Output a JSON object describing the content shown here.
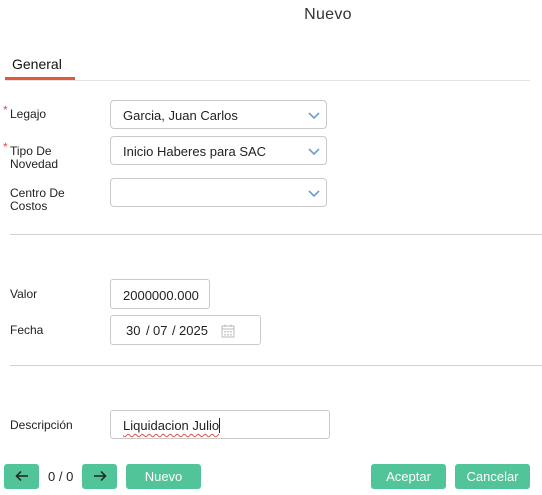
{
  "header": {
    "title": "Nuevo"
  },
  "tabs": [
    {
      "label": "General",
      "active": true
    }
  ],
  "form": {
    "legajo": {
      "label": "Legajo",
      "value": "Garcia, Juan Carlos",
      "required": true
    },
    "tipo_novedad": {
      "label_line1": "Tipo De",
      "label_line2": "Novedad",
      "value": "Inicio Haberes para SAC",
      "required": true
    },
    "centro_costos": {
      "label_line1": "Centro De",
      "label_line2": "Costos",
      "value": ""
    },
    "valor": {
      "label": "Valor",
      "value": "2000000.000"
    },
    "fecha": {
      "label": "Fecha",
      "day": "30",
      "month": "07",
      "year": "2025",
      "sep": "/"
    },
    "descripcion": {
      "label": "Descripción",
      "value": "Liquidacion Julio"
    }
  },
  "footer": {
    "counter": "0 / 0",
    "nuevo_label": "Nuevo",
    "aceptar_label": "Aceptar",
    "cancelar_label": "Cancelar"
  },
  "colors": {
    "accent": "#52c49a",
    "tab_underline": "#e05a3a",
    "required": "#d9534f"
  },
  "icons": {
    "prev": "arrow-left-icon",
    "next": "arrow-right-icon",
    "dropdown": "chevron-down-icon",
    "calendar": "calendar-icon"
  }
}
